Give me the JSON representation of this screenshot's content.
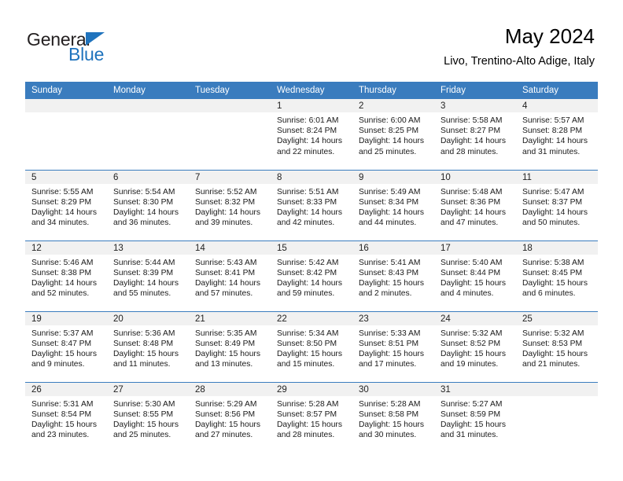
{
  "logo": {
    "primary_text": "General",
    "secondary_text": "Blue",
    "accent_color": "#1f73bd",
    "triangle_icon": "triangle-icon"
  },
  "header": {
    "title": "May 2024",
    "subtitle": "Livo, Trentino-Alto Adige, Italy"
  },
  "calendar": {
    "header_background": "#3a7cbe",
    "daynum_background": "#f1f1f1",
    "weekday_headers": [
      "Sunday",
      "Monday",
      "Tuesday",
      "Wednesday",
      "Thursday",
      "Friday",
      "Saturday"
    ],
    "weeks": [
      [
        {
          "day": "",
          "sunrise": "",
          "sunset": "",
          "daylight_line1": "",
          "daylight_line2": ""
        },
        {
          "day": "",
          "sunrise": "",
          "sunset": "",
          "daylight_line1": "",
          "daylight_line2": ""
        },
        {
          "day": "",
          "sunrise": "",
          "sunset": "",
          "daylight_line1": "",
          "daylight_line2": ""
        },
        {
          "day": "1",
          "sunrise": "Sunrise: 6:01 AM",
          "sunset": "Sunset: 8:24 PM",
          "daylight_line1": "Daylight: 14 hours",
          "daylight_line2": "and 22 minutes."
        },
        {
          "day": "2",
          "sunrise": "Sunrise: 6:00 AM",
          "sunset": "Sunset: 8:25 PM",
          "daylight_line1": "Daylight: 14 hours",
          "daylight_line2": "and 25 minutes."
        },
        {
          "day": "3",
          "sunrise": "Sunrise: 5:58 AM",
          "sunset": "Sunset: 8:27 PM",
          "daylight_line1": "Daylight: 14 hours",
          "daylight_line2": "and 28 minutes."
        },
        {
          "day": "4",
          "sunrise": "Sunrise: 5:57 AM",
          "sunset": "Sunset: 8:28 PM",
          "daylight_line1": "Daylight: 14 hours",
          "daylight_line2": "and 31 minutes."
        }
      ],
      [
        {
          "day": "5",
          "sunrise": "Sunrise: 5:55 AM",
          "sunset": "Sunset: 8:29 PM",
          "daylight_line1": "Daylight: 14 hours",
          "daylight_line2": "and 34 minutes."
        },
        {
          "day": "6",
          "sunrise": "Sunrise: 5:54 AM",
          "sunset": "Sunset: 8:30 PM",
          "daylight_line1": "Daylight: 14 hours",
          "daylight_line2": "and 36 minutes."
        },
        {
          "day": "7",
          "sunrise": "Sunrise: 5:52 AM",
          "sunset": "Sunset: 8:32 PM",
          "daylight_line1": "Daylight: 14 hours",
          "daylight_line2": "and 39 minutes."
        },
        {
          "day": "8",
          "sunrise": "Sunrise: 5:51 AM",
          "sunset": "Sunset: 8:33 PM",
          "daylight_line1": "Daylight: 14 hours",
          "daylight_line2": "and 42 minutes."
        },
        {
          "day": "9",
          "sunrise": "Sunrise: 5:49 AM",
          "sunset": "Sunset: 8:34 PM",
          "daylight_line1": "Daylight: 14 hours",
          "daylight_line2": "and 44 minutes."
        },
        {
          "day": "10",
          "sunrise": "Sunrise: 5:48 AM",
          "sunset": "Sunset: 8:36 PM",
          "daylight_line1": "Daylight: 14 hours",
          "daylight_line2": "and 47 minutes."
        },
        {
          "day": "11",
          "sunrise": "Sunrise: 5:47 AM",
          "sunset": "Sunset: 8:37 PM",
          "daylight_line1": "Daylight: 14 hours",
          "daylight_line2": "and 50 minutes."
        }
      ],
      [
        {
          "day": "12",
          "sunrise": "Sunrise: 5:46 AM",
          "sunset": "Sunset: 8:38 PM",
          "daylight_line1": "Daylight: 14 hours",
          "daylight_line2": "and 52 minutes."
        },
        {
          "day": "13",
          "sunrise": "Sunrise: 5:44 AM",
          "sunset": "Sunset: 8:39 PM",
          "daylight_line1": "Daylight: 14 hours",
          "daylight_line2": "and 55 minutes."
        },
        {
          "day": "14",
          "sunrise": "Sunrise: 5:43 AM",
          "sunset": "Sunset: 8:41 PM",
          "daylight_line1": "Daylight: 14 hours",
          "daylight_line2": "and 57 minutes."
        },
        {
          "day": "15",
          "sunrise": "Sunrise: 5:42 AM",
          "sunset": "Sunset: 8:42 PM",
          "daylight_line1": "Daylight: 14 hours",
          "daylight_line2": "and 59 minutes."
        },
        {
          "day": "16",
          "sunrise": "Sunrise: 5:41 AM",
          "sunset": "Sunset: 8:43 PM",
          "daylight_line1": "Daylight: 15 hours",
          "daylight_line2": "and 2 minutes."
        },
        {
          "day": "17",
          "sunrise": "Sunrise: 5:40 AM",
          "sunset": "Sunset: 8:44 PM",
          "daylight_line1": "Daylight: 15 hours",
          "daylight_line2": "and 4 minutes."
        },
        {
          "day": "18",
          "sunrise": "Sunrise: 5:38 AM",
          "sunset": "Sunset: 8:45 PM",
          "daylight_line1": "Daylight: 15 hours",
          "daylight_line2": "and 6 minutes."
        }
      ],
      [
        {
          "day": "19",
          "sunrise": "Sunrise: 5:37 AM",
          "sunset": "Sunset: 8:47 PM",
          "daylight_line1": "Daylight: 15 hours",
          "daylight_line2": "and 9 minutes."
        },
        {
          "day": "20",
          "sunrise": "Sunrise: 5:36 AM",
          "sunset": "Sunset: 8:48 PM",
          "daylight_line1": "Daylight: 15 hours",
          "daylight_line2": "and 11 minutes."
        },
        {
          "day": "21",
          "sunrise": "Sunrise: 5:35 AM",
          "sunset": "Sunset: 8:49 PM",
          "daylight_line1": "Daylight: 15 hours",
          "daylight_line2": "and 13 minutes."
        },
        {
          "day": "22",
          "sunrise": "Sunrise: 5:34 AM",
          "sunset": "Sunset: 8:50 PM",
          "daylight_line1": "Daylight: 15 hours",
          "daylight_line2": "and 15 minutes."
        },
        {
          "day": "23",
          "sunrise": "Sunrise: 5:33 AM",
          "sunset": "Sunset: 8:51 PM",
          "daylight_line1": "Daylight: 15 hours",
          "daylight_line2": "and 17 minutes."
        },
        {
          "day": "24",
          "sunrise": "Sunrise: 5:32 AM",
          "sunset": "Sunset: 8:52 PM",
          "daylight_line1": "Daylight: 15 hours",
          "daylight_line2": "and 19 minutes."
        },
        {
          "day": "25",
          "sunrise": "Sunrise: 5:32 AM",
          "sunset": "Sunset: 8:53 PM",
          "daylight_line1": "Daylight: 15 hours",
          "daylight_line2": "and 21 minutes."
        }
      ],
      [
        {
          "day": "26",
          "sunrise": "Sunrise: 5:31 AM",
          "sunset": "Sunset: 8:54 PM",
          "daylight_line1": "Daylight: 15 hours",
          "daylight_line2": "and 23 minutes."
        },
        {
          "day": "27",
          "sunrise": "Sunrise: 5:30 AM",
          "sunset": "Sunset: 8:55 PM",
          "daylight_line1": "Daylight: 15 hours",
          "daylight_line2": "and 25 minutes."
        },
        {
          "day": "28",
          "sunrise": "Sunrise: 5:29 AM",
          "sunset": "Sunset: 8:56 PM",
          "daylight_line1": "Daylight: 15 hours",
          "daylight_line2": "and 27 minutes."
        },
        {
          "day": "29",
          "sunrise": "Sunrise: 5:28 AM",
          "sunset": "Sunset: 8:57 PM",
          "daylight_line1": "Daylight: 15 hours",
          "daylight_line2": "and 28 minutes."
        },
        {
          "day": "30",
          "sunrise": "Sunrise: 5:28 AM",
          "sunset": "Sunset: 8:58 PM",
          "daylight_line1": "Daylight: 15 hours",
          "daylight_line2": "and 30 minutes."
        },
        {
          "day": "31",
          "sunrise": "Sunrise: 5:27 AM",
          "sunset": "Sunset: 8:59 PM",
          "daylight_line1": "Daylight: 15 hours",
          "daylight_line2": "and 31 minutes."
        },
        {
          "day": "",
          "sunrise": "",
          "sunset": "",
          "daylight_line1": "",
          "daylight_line2": ""
        }
      ]
    ]
  }
}
